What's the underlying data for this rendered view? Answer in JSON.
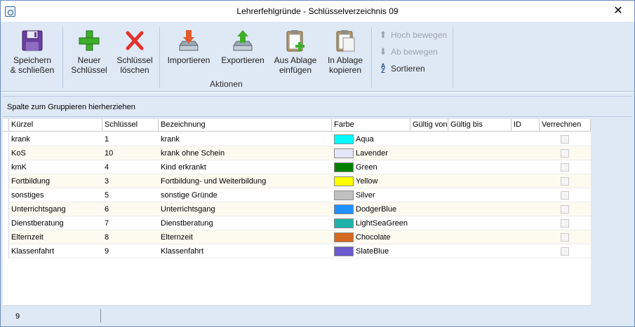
{
  "window": {
    "title": "Lehrerfehlgründe - Schlüsselverzeichnis 09",
    "close_glyph": "✕"
  },
  "ribbon": {
    "buttons": [
      {
        "label": "Speichern\n& schließen",
        "icon": "save-disk-icon"
      },
      {
        "label": "Neuer\nSchlüssel",
        "icon": "plus-icon"
      },
      {
        "label": "Schlüssel\nlöschen",
        "icon": "delete-x-icon"
      },
      {
        "label": "Importieren",
        "icon": "import-icon"
      },
      {
        "label": "Exportieren",
        "icon": "export-icon"
      },
      {
        "label": "Aus Ablage\neinfügen",
        "icon": "paste-clipboard-icon"
      },
      {
        "label": "In Ablage\nkopieren",
        "icon": "copy-clipboard-icon"
      }
    ],
    "small_buttons": [
      {
        "label": "Hoch bewegen",
        "icon": "arrow-up-icon",
        "enabled": false
      },
      {
        "label": "Ab bewegen",
        "icon": "arrow-down-icon",
        "enabled": false
      },
      {
        "label": "Sortieren",
        "icon": "sort-az-icon",
        "enabled": true
      }
    ],
    "group_label": "Aktionen"
  },
  "grid": {
    "group_hint": "Spalte zum Gruppieren hierherziehen",
    "columns": [
      "Kürzel",
      "Schlüssel",
      "Bezeichnung",
      "Farbe",
      "Gültig von",
      "Gültig bis",
      "ID",
      "Verrechnen"
    ],
    "rows": [
      {
        "kuerzel": "krank",
        "schluessel": "1",
        "bezeichnung": "krank",
        "farbe": "Aqua",
        "color": "#00ffff",
        "verrechnen": false
      },
      {
        "kuerzel": "KoS",
        "schluessel": "10",
        "bezeichnung": "krank ohne Schein",
        "farbe": "Lavender",
        "color": "#e6e6fa",
        "verrechnen": false
      },
      {
        "kuerzel": "kmK",
        "schluessel": "4",
        "bezeichnung": "Kind erkrankt",
        "farbe": "Green",
        "color": "#008000",
        "verrechnen": false
      },
      {
        "kuerzel": "Fortbildung",
        "schluessel": "3",
        "bezeichnung": "Fortbildung- und Weiterbildung",
        "farbe": "Yellow",
        "color": "#ffff00",
        "verrechnen": false
      },
      {
        "kuerzel": "sonstiges",
        "schluessel": "5",
        "bezeichnung": "sonstige Gründe",
        "farbe": "Silver",
        "color": "#c0c0c0",
        "verrechnen": false
      },
      {
        "kuerzel": "Unterrichtsgang",
        "schluessel": "6",
        "bezeichnung": "Unterrichtsgang",
        "farbe": "DodgerBlue",
        "color": "#1e90ff",
        "verrechnen": false
      },
      {
        "kuerzel": "Dienstberatung",
        "schluessel": "7",
        "bezeichnung": "Dienstberatung",
        "farbe": "LightSeaGreen",
        "color": "#20b2aa",
        "verrechnen": false
      },
      {
        "kuerzel": "Elternzeit",
        "schluessel": "8",
        "bezeichnung": "Elternzeit",
        "farbe": "Chocolate",
        "color": "#d2691e",
        "verrechnen": false
      },
      {
        "kuerzel": "Klassenfahrt",
        "schluessel": "9",
        "bezeichnung": "Klassenfahrt",
        "farbe": "SlateBlue",
        "color": "#6a5acd",
        "verrechnen": false
      }
    ]
  },
  "footer": {
    "count": "9"
  }
}
